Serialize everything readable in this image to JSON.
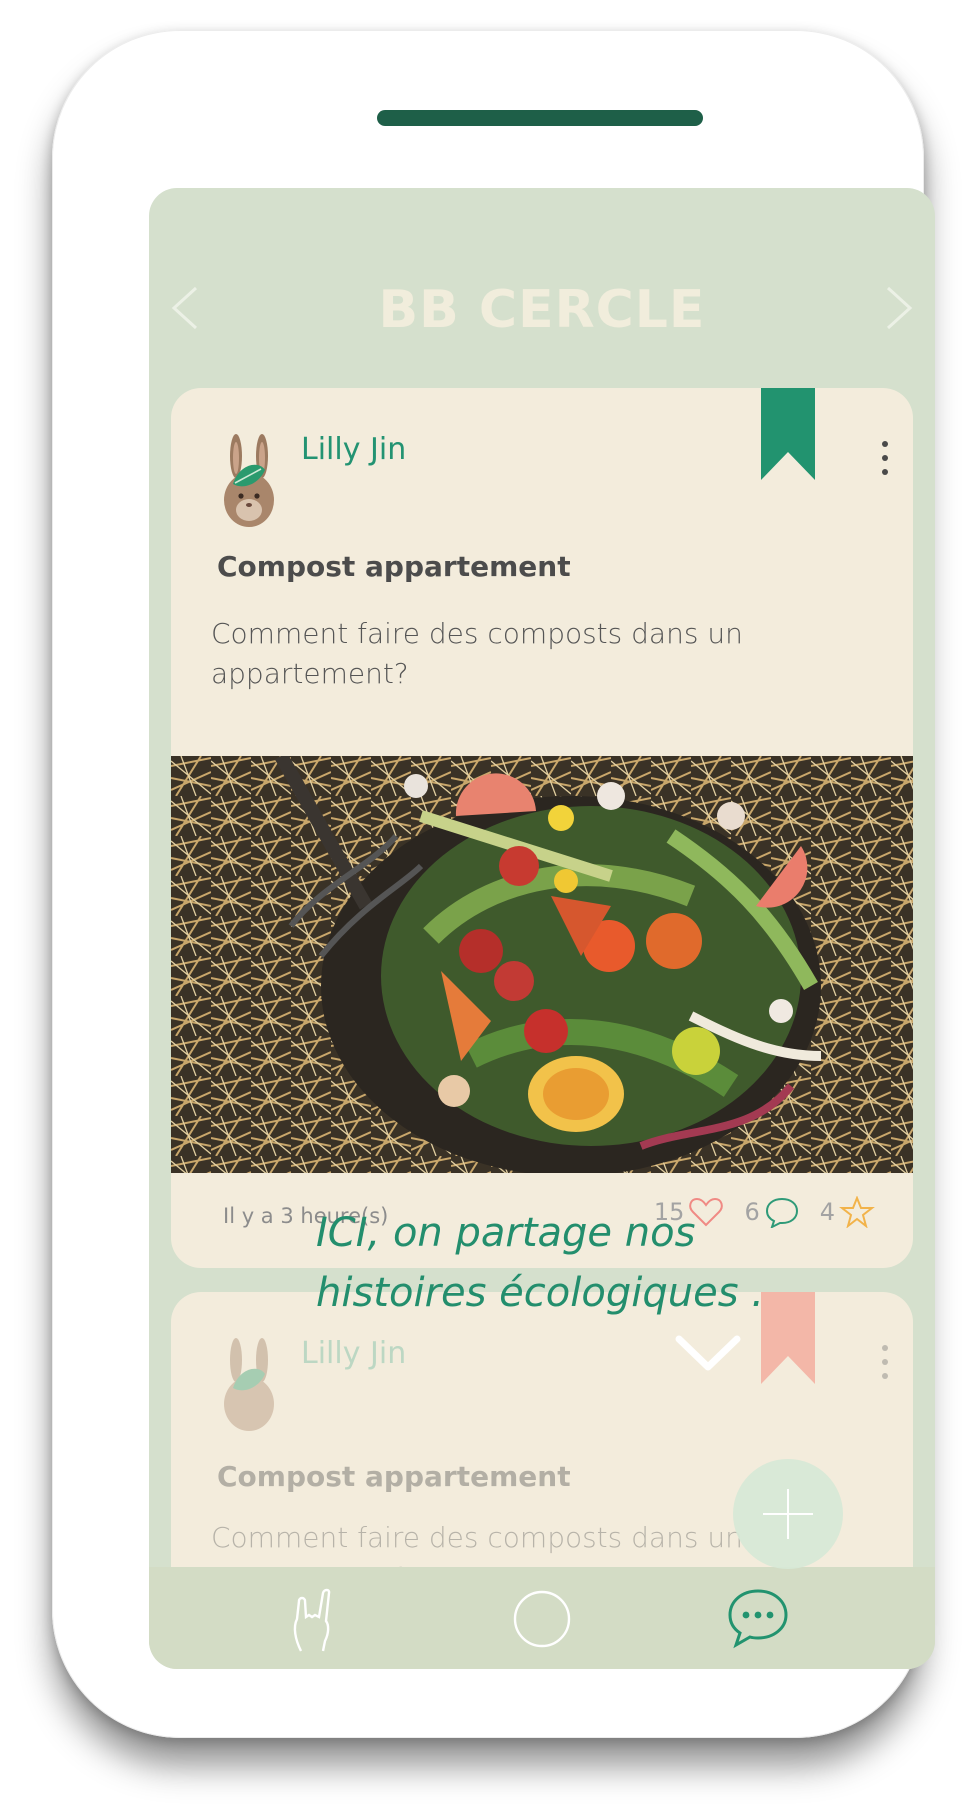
{
  "header": {
    "title": "BB CERCLE",
    "prev_icon": "chevron-left-icon",
    "next_icon": "chevron-right-icon"
  },
  "post": {
    "author": "Lilly Jin",
    "title": "Compost appartement",
    "body": "Comment faire des composts dans un appartement?",
    "time": "Il y a 3 heure(s)",
    "likes": "15",
    "comments": "6",
    "favorites": "4",
    "bookmark_color": "#22936f"
  },
  "next_post": {
    "author": "Lilly Jin",
    "title": "Compost appartement",
    "body": "Comment faire des composts dans un appartement?",
    "bookmark_color": "#f3b7a8"
  },
  "overlay": {
    "slogan_line1": "ICI, on partage nos",
    "slogan_line2": "histoires écologiques ."
  },
  "tabs": [
    {
      "icon": "rock-hand-icon"
    },
    {
      "icon": "circle-icon"
    },
    {
      "icon": "chat-bubble-icon"
    }
  ],
  "colors": {
    "accent": "#22936f",
    "screen_bg": "#d5e0cd",
    "card_bg": "#f3ecdc",
    "title_text": "#f1eddc"
  }
}
